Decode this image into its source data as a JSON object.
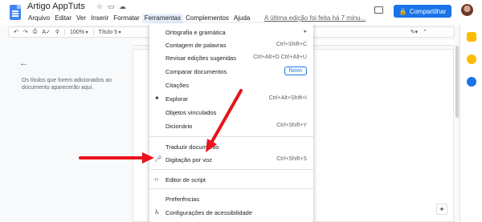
{
  "app": {
    "title": "Artigo AppTuts",
    "last_edit": "A última edição foi feita há 7 minu...",
    "share_label": "Compartilhar"
  },
  "menubar": [
    "Arquivo",
    "Editar",
    "Ver",
    "Inserir",
    "Formatar",
    "Ferramentas",
    "Complementos",
    "Ajuda"
  ],
  "toolbar": {
    "zoom": "100%",
    "style": "Título 5"
  },
  "outline": {
    "message": "Os títulos que forem adicionados ao documento aparecerão aqui."
  },
  "tools_menu": {
    "items": [
      {
        "label": "Ortografia e gramática",
        "shortcut": "",
        "icon": "",
        "submenu": true
      },
      {
        "label": "Contagem de palavras",
        "shortcut": "Ctrl+Shift+C",
        "icon": ""
      },
      {
        "label": "Revisar edições sugeridas",
        "shortcut": "Ctrl+Alt+O Ctrl+Alt+U",
        "icon": ""
      },
      {
        "label": "Comparar documentos",
        "shortcut": "",
        "icon": "",
        "badge": "Novo"
      },
      {
        "label": "Citações",
        "shortcut": "",
        "icon": ""
      },
      {
        "label": "Explorar",
        "shortcut": "Ctrl+Alt+Shift+I",
        "icon": "explore-icon"
      },
      {
        "label": "Objetos vinculados",
        "shortcut": "",
        "icon": ""
      },
      {
        "label": "Dicionário",
        "shortcut": "Ctrl+Shift+Y",
        "icon": ""
      },
      {
        "label": "Traduzir documento",
        "shortcut": "",
        "icon": ""
      },
      {
        "label": "Digitação por voz",
        "shortcut": "Ctrl+Shift+S",
        "icon": "microphone-icon"
      },
      {
        "label": "Editor de script",
        "shortcut": "",
        "icon": "code-icon"
      },
      {
        "label": "Preferências",
        "shortcut": "",
        "icon": ""
      },
      {
        "label": "Configurações de acessibilidade",
        "shortcut": "",
        "icon": "accessibility-icon"
      }
    ]
  },
  "colors": {
    "accent": "#1a73e8",
    "arrow": "#e8121c",
    "menu_active": "#e8f0fe"
  }
}
